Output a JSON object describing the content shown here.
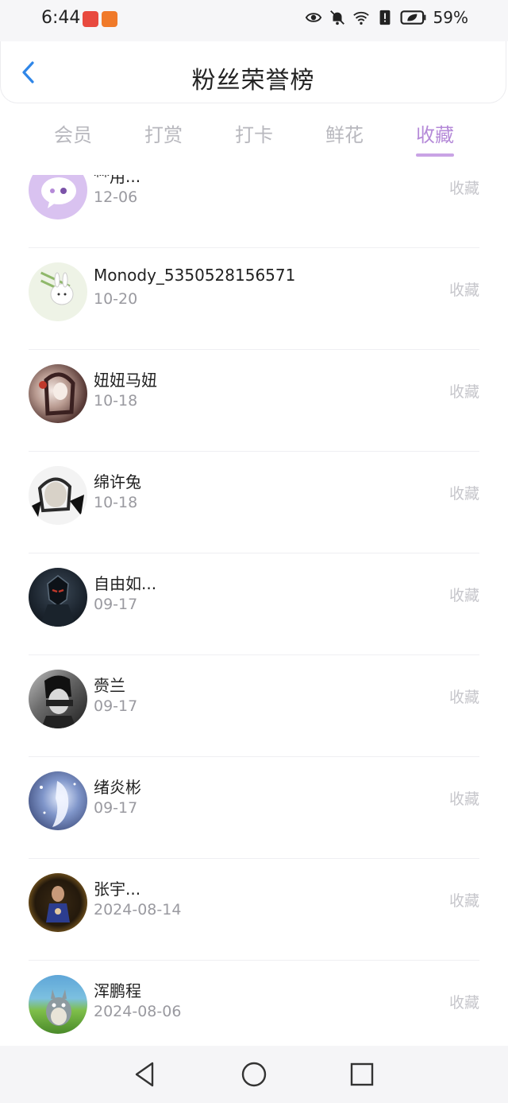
{
  "status": {
    "time": "6:44",
    "battery": "59%"
  },
  "header": {
    "title": "粉丝荣誉榜"
  },
  "tabs": [
    {
      "label": "会员"
    },
    {
      "label": "打赏"
    },
    {
      "label": "打卡"
    },
    {
      "label": "鲜花"
    },
    {
      "label": "收藏"
    }
  ],
  "fans": [
    {
      "name": "**用...",
      "date": "12-06",
      "action": "收藏",
      "avatar": "chat-bubble-avatar"
    },
    {
      "name": "Monody_5350528156571",
      "date": "10-20",
      "action": "收藏",
      "avatar": "rabbit-avatar"
    },
    {
      "name": "妞妞马妞",
      "date": "10-18",
      "action": "收藏",
      "avatar": "anime-girl-avatar"
    },
    {
      "name": "绵许兔",
      "date": "10-18",
      "action": "收藏",
      "avatar": "monochrome-girl-avatar"
    },
    {
      "name": "自由如...",
      "date": "09-17",
      "action": "收藏",
      "avatar": "dark-knight-avatar"
    },
    {
      "name": "赍兰",
      "date": "09-17",
      "action": "收藏",
      "avatar": "bw-portrait-avatar"
    },
    {
      "name": "绪炎彬",
      "date": "09-17",
      "action": "收藏",
      "avatar": "blue-fantasy-avatar"
    },
    {
      "name": "张宇...",
      "date": "2024-08-14",
      "action": "收藏",
      "avatar": "person-gold-frame-avatar"
    },
    {
      "name": "浑鹏程",
      "date": "2024-08-06",
      "action": "收藏",
      "avatar": "totoro-avatar"
    }
  ],
  "colors": {
    "accent": "#b58ad8",
    "tab_inactive": "#b8b8be",
    "back_arrow": "#2f86e8"
  }
}
